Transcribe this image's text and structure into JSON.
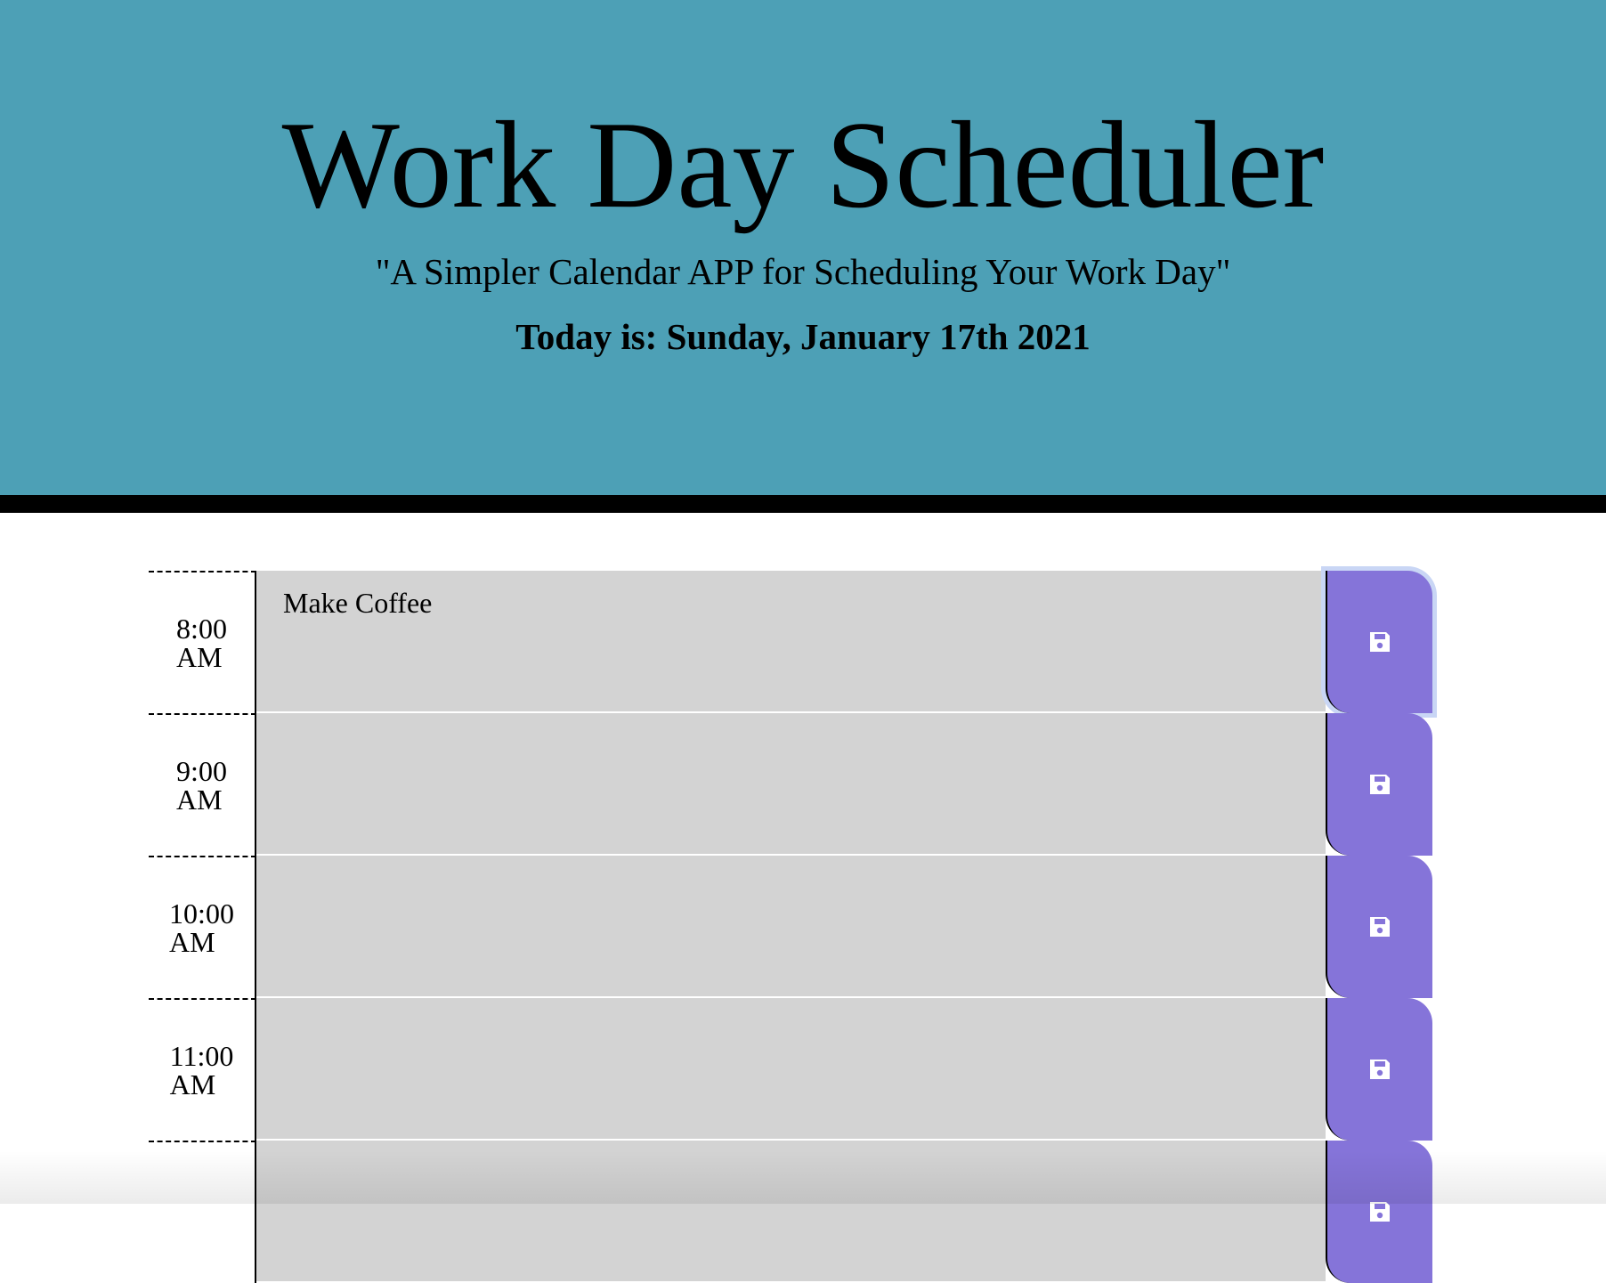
{
  "header": {
    "title": "Work Day Scheduler",
    "tagline": "\"A Simpler Calendar APP for Scheduling Your Work Day\"",
    "date_prefix": "Today is: ",
    "date": "Sunday, January 17th 2021"
  },
  "colors": {
    "header_bg": "#4da0b6",
    "past_row": "#d3d3d3",
    "save_button": "#8574d9"
  },
  "time_blocks": [
    {
      "hour": "8:00",
      "meridiem": "AM",
      "text": "Make Coffee",
      "save_icon": "save-icon"
    },
    {
      "hour": "9:00",
      "meridiem": "AM",
      "text": "",
      "save_icon": "save-icon"
    },
    {
      "hour": "10:00",
      "meridiem": "AM",
      "text": "",
      "save_icon": "save-icon"
    },
    {
      "hour": "11:00",
      "meridiem": "AM",
      "text": "",
      "save_icon": "save-icon"
    },
    {
      "hour": "",
      "meridiem": "",
      "text": "",
      "save_icon": "save-icon"
    }
  ]
}
